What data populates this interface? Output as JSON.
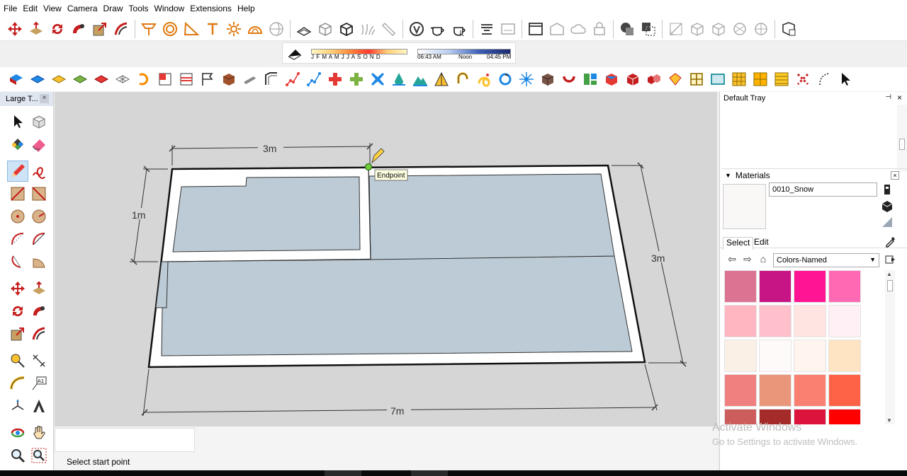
{
  "menu": [
    "File",
    "Edit",
    "View",
    "Camera",
    "Draw",
    "Tools",
    "Window",
    "Extensions",
    "Help"
  ],
  "shadows": {
    "months": "J F M A M J J A S O N D",
    "time_start": "06:43 AM",
    "time_mid": "Noon",
    "time_end": "04:45 PM"
  },
  "left_panel": {
    "title": "Large T...",
    "close": "×"
  },
  "viewport": {
    "dimensions": [
      "3m",
      "1m",
      "3m",
      "7m"
    ],
    "inference_tooltip": "Endpoint"
  },
  "status": {
    "prompt": "Select start point",
    "measurements": ""
  },
  "tray": {
    "title": "Default Tray",
    "pin": "⊣",
    "close": "×",
    "materials": {
      "header": "Materials",
      "toggle": "▼",
      "close": "×",
      "current_name": "0010_Snow",
      "tabs": [
        "Select",
        "Edit"
      ],
      "collection": "Colors-Named",
      "swatches": [
        "#dc7393",
        "#c71585",
        "#ff1493",
        "#ff69b4",
        "#ffb6c1",
        "#ffc0cb",
        "#ffe4e1",
        "#fff0f5",
        "#faf0e6",
        "#fffafa",
        "#fff5ee",
        "#ffe4c4",
        "#f08080",
        "#e9967a",
        "#fa8072",
        "#ff6347",
        "#cd5c5c",
        "#a52a2a",
        "#dc143c",
        "#ff0000"
      ]
    }
  },
  "watermark": {
    "title": "Activate Windows",
    "subtitle": "Go to Settings to activate Windows."
  }
}
